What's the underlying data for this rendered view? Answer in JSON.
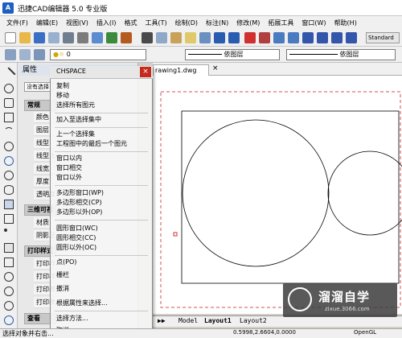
{
  "app": {
    "title": "迅捷CAD编辑器 5.0 专业版",
    "icon_label": "A"
  },
  "menu": [
    "文件(F)",
    "编辑(E)",
    "视图(V)",
    "插入(I)",
    "格式",
    "工具(T)",
    "绘制(D)",
    "标注(N)",
    "修改(M)",
    "拓展工具",
    "窗口(W)",
    "帮助(H)"
  ],
  "toolbar": {
    "style_box": "Standard",
    "layer_value": "0",
    "linetype_value": "依图层",
    "lineweight_value": "依图层"
  },
  "props": {
    "title": "属性",
    "no_selection": "没有选择",
    "section_general": "常规",
    "rows_general": [
      "颜色",
      "图层",
      "线型",
      "线型比",
      "线宽",
      "厚度",
      "透明度"
    ],
    "section_3d": "三维可视",
    "rows_3d": [
      "材质",
      "阴影显"
    ],
    "section_print": "打印样式",
    "rows_print": [
      "打印样",
      "打印样",
      "打印表",
      "打印表"
    ],
    "section_view": "查看"
  },
  "ctx_menu": {
    "title": "CHSPACE",
    "close": "×",
    "items": [
      "复制",
      "移动",
      "选择所有图元",
      "加入至选择集中",
      "上一个选择集",
      "工程图中的最后一个图元",
      "窗口以内",
      "窗口相交",
      "窗口以外",
      "多边形窗口(WP)",
      "多边形相交(CP)",
      "多边形以外(OP)",
      "圆形窗口(WC)",
      "圆形相交(CC)",
      "圆形以外(OC)",
      "点(PO)",
      "栅栏",
      "撤消",
      "根据属性来选择...",
      "选择方法...",
      "取消"
    ]
  },
  "document": {
    "tab_label": "rawing1.dwg",
    "tab_close": "×"
  },
  "layouts": {
    "model": "Model",
    "layout1": "Layout1",
    "layout2": "Layout2"
  },
  "status": {
    "prompt": "选择对象并右击...",
    "coords": "0.5998,2.6604,0.0000",
    "open_label": "OpenGL"
  },
  "watermark": {
    "text": "溜溜自学",
    "url": "zixue.3066.com"
  }
}
